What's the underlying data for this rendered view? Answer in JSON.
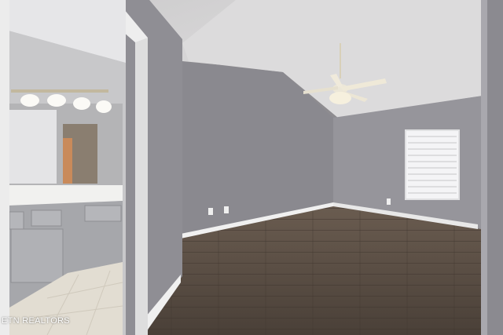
{
  "watermark": {
    "text": "ETN REALTORS"
  },
  "colors": {
    "wall": "#8f8e94",
    "wall_shadow": "#7f7e84",
    "ceiling": "#d9d8da",
    "floor": "#5e5248",
    "trim": "#f2f2f2",
    "bath_wall": "#c9c9cb"
  }
}
